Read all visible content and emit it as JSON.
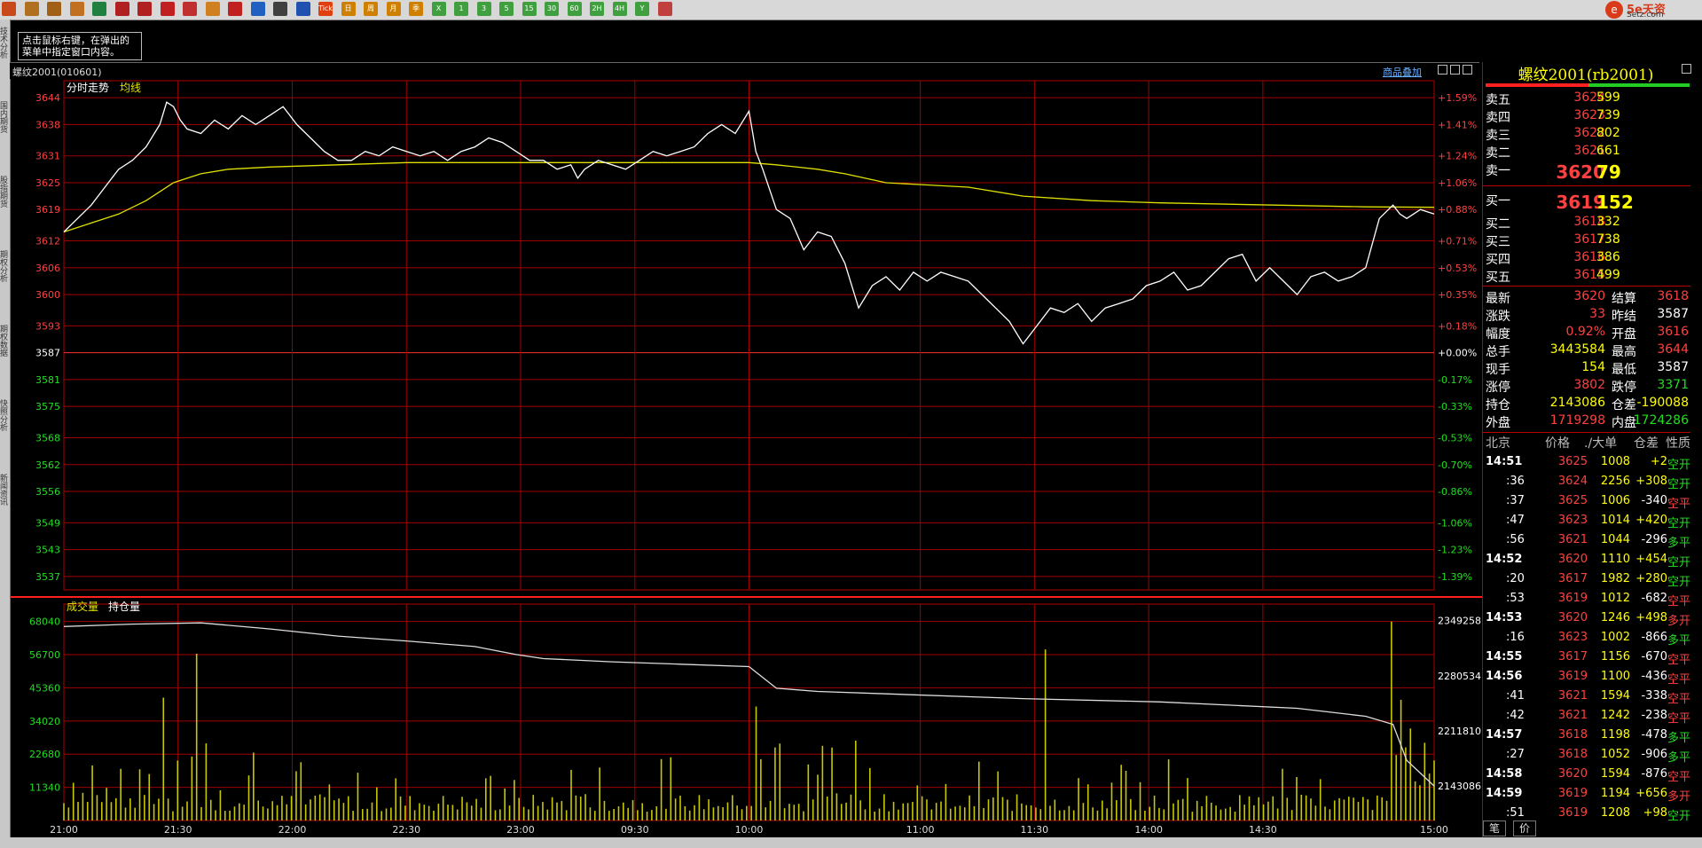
{
  "toolbar": {
    "items": [
      "home-icon",
      "stack-icon",
      "folder-icon",
      "book-icon",
      "refresh-icon",
      "zoom-in-icon",
      "zoom-out-icon",
      "window-icon",
      "pencil-icon",
      "brush-icon",
      "filter-icon",
      "new-icon",
      "table-icon",
      "trend-icon",
      "tick",
      "D",
      "W",
      "M",
      "Q",
      "Y",
      "1",
      "3",
      "5",
      "15",
      "30",
      "60",
      "2H",
      "4H",
      "Y",
      "calc-icon"
    ],
    "labels": {
      "tick": "Tick",
      "D": "日",
      "W": "周",
      "M": "月",
      "Q": "季",
      "Y": "X",
      "1": "1",
      "3": "3",
      "5": "5",
      "15": "15",
      "30": "30",
      "60": "60",
      "2H": "2H",
      "4H": "4H",
      "Yr": "Y"
    }
  },
  "brand": {
    "logo_text": "5e天资",
    "logo_sub": "Setz.com",
    "accent": "#d83a1a"
  },
  "left_tabs": [
    "技术分析",
    "国内期货",
    "股指期货",
    "期权分析",
    "期权数据",
    "快照分析",
    "新闻资讯"
  ],
  "tip": {
    "line1": "点击鼠标右键，在弹出的",
    "line2": "菜单中指定窗口内容。"
  },
  "header": {
    "symbol": "螺纹2001(010601)",
    "overlay_link": "商品叠加"
  },
  "chart_data": {
    "type": "line",
    "panels": [
      {
        "name": "price",
        "legend": [
          "分时走势",
          "均线"
        ],
        "y_ticks": [
          3644,
          3638,
          3631,
          3625,
          3619,
          3612,
          3606,
          3600,
          3593,
          3587,
          3581,
          3575,
          3568,
          3562,
          3556,
          3549,
          3543,
          3537
        ],
        "pct_ticks": [
          "+1.59%",
          "+1.41%",
          "+1.24%",
          "+1.06%",
          "+0.88%",
          "+0.71%",
          "+0.53%",
          "+0.35%",
          "+0.18%",
          "+0.00%",
          "-0.17%",
          "-0.33%",
          "-0.53%",
          "-0.70%",
          "-0.86%",
          "-1.06%",
          "-1.23%",
          "-1.39%"
        ],
        "ylim": [
          3534,
          3647
        ],
        "prev_settle": 3587
      },
      {
        "name": "volume",
        "legend": [
          "成交量",
          "持仓量"
        ],
        "y_ticks": [
          68040,
          56700,
          45360,
          34020,
          22680,
          11340
        ],
        "oi_ticks": [
          2349258,
          2280534,
          2211810,
          2143086
        ],
        "ylim": [
          0,
          74000
        ]
      }
    ],
    "x_ticks": [
      "21:00",
      "21:30",
      "22:00",
      "22:30",
      "23:00",
      "09:30",
      "10:00",
      "11:00",
      "11:30",
      "14:00",
      "14:30",
      "15:00"
    ],
    "x_tick_pos": [
      0,
      0.0833,
      0.1667,
      0.25,
      0.3333,
      0.4167,
      0.5,
      0.625,
      0.7083,
      0.7917,
      0.875,
      1
    ],
    "series": [
      {
        "name": "分时走势",
        "x": [
          0,
          0.01,
          0.02,
          0.03,
          0.04,
          0.05,
          0.06,
          0.07,
          0.075,
          0.08,
          0.085,
          0.09,
          0.1,
          0.11,
          0.12,
          0.13,
          0.14,
          0.15,
          0.16,
          0.17,
          0.18,
          0.19,
          0.2,
          0.21,
          0.22,
          0.23,
          0.24,
          0.25,
          0.26,
          0.27,
          0.28,
          0.29,
          0.3,
          0.31,
          0.32,
          0.33,
          0.34,
          0.35,
          0.36,
          0.37,
          0.375,
          0.38,
          0.39,
          0.4,
          0.41,
          0.42,
          0.43,
          0.44,
          0.45,
          0.46,
          0.47,
          0.48,
          0.49,
          0.5,
          0.505,
          0.51,
          0.52,
          0.53,
          0.54,
          0.55,
          0.56,
          0.57,
          0.58,
          0.59,
          0.6,
          0.61,
          0.62,
          0.63,
          0.64,
          0.65,
          0.66,
          0.67,
          0.68,
          0.69,
          0.7,
          0.71,
          0.72,
          0.73,
          0.74,
          0.75,
          0.76,
          0.77,
          0.78,
          0.79,
          0.8,
          0.81,
          0.82,
          0.83,
          0.84,
          0.85,
          0.86,
          0.87,
          0.88,
          0.89,
          0.9,
          0.91,
          0.92,
          0.93,
          0.94,
          0.95,
          0.96,
          0.97,
          0.975,
          0.98,
          0.99,
          1
        ],
        "values": [
          3614,
          3617,
          3620,
          3624,
          3628,
          3630,
          3633,
          3638,
          3643,
          3642,
          3639,
          3637,
          3636,
          3639,
          3637,
          3640,
          3638,
          3640,
          3642,
          3638,
          3635,
          3632,
          3630,
          3630,
          3632,
          3631,
          3633,
          3632,
          3631,
          3632,
          3630,
          3632,
          3633,
          3635,
          3634,
          3632,
          3630,
          3630,
          3628,
          3629,
          3626,
          3628,
          3630,
          3629,
          3628,
          3630,
          3632,
          3631,
          3632,
          3633,
          3636,
          3638,
          3636,
          3641,
          3632,
          3628,
          3619,
          3617,
          3610,
          3614,
          3613,
          3607,
          3597,
          3602,
          3604,
          3601,
          3605,
          3603,
          3605,
          3604,
          3603,
          3600,
          3597,
          3594,
          3589,
          3593,
          3597,
          3596,
          3598,
          3594,
          3597,
          3598,
          3599,
          3602,
          3603,
          3605,
          3601,
          3602,
          3605,
          3608,
          3609,
          3603,
          3606,
          3603,
          3600,
          3604,
          3605,
          3603,
          3604,
          3606,
          3617,
          3620,
          3618,
          3617,
          3619,
          3618
        ],
        "color": "#ffffff"
      },
      {
        "name": "均线",
        "x": [
          0,
          0.02,
          0.04,
          0.06,
          0.07,
          0.08,
          0.09,
          0.1,
          0.12,
          0.15,
          0.2,
          0.25,
          0.3,
          0.35,
          0.4,
          0.45,
          0.5,
          0.52,
          0.55,
          0.57,
          0.6,
          0.63,
          0.66,
          0.7,
          0.75,
          0.8,
          0.85,
          0.9,
          0.95,
          1
        ],
        "values": [
          3614,
          3616,
          3618,
          3621,
          3623,
          3625,
          3626,
          3627,
          3628,
          3628.5,
          3629,
          3629.5,
          3629.5,
          3629.5,
          3629.5,
          3629.5,
          3629.5,
          3629,
          3628,
          3627,
          3625,
          3624.5,
          3624,
          3622,
          3621,
          3620.5,
          3620.2,
          3619.9,
          3619.6,
          3619.5
        ],
        "color": "#e0e000"
      },
      {
        "name": "持仓量",
        "x": [
          0,
          0.05,
          0.1,
          0.15,
          0.2,
          0.25,
          0.3,
          0.33,
          0.35,
          0.4,
          0.45,
          0.5,
          0.52,
          0.55,
          0.6,
          0.7,
          0.8,
          0.85,
          0.9,
          0.95,
          0.97,
          0.98,
          1
        ],
        "values": [
          2342000,
          2345000,
          2346500,
          2339000,
          2330000,
          2324000,
          2317000,
          2307000,
          2302000,
          2298000,
          2295000,
          2292000,
          2265000,
          2261000,
          2258000,
          2252000,
          2248000,
          2244000,
          2240000,
          2230000,
          2220000,
          2175000,
          2143086
        ],
        "color": "#dddddd"
      }
    ],
    "volume_bars": {
      "color": "#c8c800"
    },
    "grid": true
  },
  "quote": {
    "title": "螺纹2001(rb2001)",
    "asks": [
      {
        "label": "卖五",
        "price": "3624",
        "vol": "599"
      },
      {
        "label": "卖四",
        "price": "3623",
        "vol": "739"
      },
      {
        "label": "卖三",
        "price": "3622",
        "vol": "802"
      },
      {
        "label": "卖二",
        "price": "3621",
        "vol": "661"
      }
    ],
    "ask1": {
      "label": "卖一",
      "price": "3620",
      "vol": "79"
    },
    "bid1": {
      "label": "买一",
      "price": "3619",
      "vol": "152"
    },
    "bids": [
      {
        "label": "买二",
        "price": "3618",
        "vol": "332"
      },
      {
        "label": "买三",
        "price": "3617",
        "vol": "738"
      },
      {
        "label": "买四",
        "price": "3616",
        "vol": "386"
      },
      {
        "label": "买五",
        "price": "3615",
        "vol": "499"
      }
    ],
    "stats": [
      {
        "l1": "最新",
        "v1": "3620",
        "c1": "red",
        "l2": "结算",
        "v2": "3618",
        "c2": "red"
      },
      {
        "l1": "涨跌",
        "v1": "33",
        "c1": "red",
        "l2": "昨结",
        "v2": "3587",
        "c2": "wht"
      },
      {
        "l1": "幅度",
        "v1": "0.92%",
        "c1": "red",
        "l2": "开盘",
        "v2": "3616",
        "c2": "red"
      },
      {
        "l1": "总手",
        "v1": "3443584",
        "c1": "yel",
        "l2": "最高",
        "v2": "3644",
        "c2": "red"
      },
      {
        "l1": "现手",
        "v1": "154",
        "c1": "yel",
        "l2": "最低",
        "v2": "3587",
        "c2": "wht"
      },
      {
        "l1": "涨停",
        "v1": "3802",
        "c1": "red",
        "l2": "跌停",
        "v2": "3371",
        "c2": "green"
      },
      {
        "l1": "持仓",
        "v1": "2143086",
        "c1": "yel",
        "l2": "仓差",
        "v2": "-190088",
        "c2": "yel"
      },
      {
        "l1": "外盘",
        "v1": "1719298",
        "c1": "red",
        "l2": "内盘",
        "v2": "1724286",
        "c2": "green"
      }
    ],
    "trade_header": {
      "time": "北京",
      "price": "价格",
      "vol": "./大单",
      "oi": "仓差",
      "type": "性质"
    },
    "trades": [
      {
        "t": "14:51",
        "p": "3625",
        "v": "1008",
        "d": "+2",
        "k": "空开",
        "kc": "green"
      },
      {
        "t": ":36",
        "p": "3624",
        "v": "2256",
        "d": "+308",
        "k": "空开",
        "kc": "green"
      },
      {
        "t": ":37",
        "p": "3625",
        "v": "1006",
        "d": "-340",
        "k": "空平",
        "kc": "red"
      },
      {
        "t": ":47",
        "p": "3623",
        "v": "1014",
        "d": "+420",
        "k": "空开",
        "kc": "green"
      },
      {
        "t": ":56",
        "p": "3621",
        "v": "1044",
        "d": "-296",
        "k": "多平",
        "kc": "green"
      },
      {
        "t": "14:52",
        "p": "3620",
        "v": "1110",
        "d": "+454",
        "k": "空开",
        "kc": "green"
      },
      {
        "t": ":20",
        "p": "3617",
        "v": "1982",
        "d": "+280",
        "k": "空开",
        "kc": "green"
      },
      {
        "t": ":53",
        "p": "3619",
        "v": "1012",
        "d": "-682",
        "k": "空平",
        "kc": "red"
      },
      {
        "t": "14:53",
        "p": "3620",
        "v": "1246",
        "d": "+498",
        "k": "多开",
        "kc": "red"
      },
      {
        "t": ":16",
        "p": "3623",
        "v": "1002",
        "d": "-866",
        "k": "多平",
        "kc": "green"
      },
      {
        "t": "14:55",
        "p": "3617",
        "v": "1156",
        "d": "-670",
        "k": "空平",
        "kc": "red"
      },
      {
        "t": "14:56",
        "p": "3619",
        "v": "1100",
        "d": "-436",
        "k": "空平",
        "kc": "red"
      },
      {
        "t": ":41",
        "p": "3621",
        "v": "1594",
        "d": "-338",
        "k": "空平",
        "kc": "red"
      },
      {
        "t": ":42",
        "p": "3621",
        "v": "1242",
        "d": "-238",
        "k": "空平",
        "kc": "red"
      },
      {
        "t": "14:57",
        "p": "3618",
        "v": "1198",
        "d": "-478",
        "k": "多平",
        "kc": "green"
      },
      {
        "t": ":27",
        "p": "3618",
        "v": "1052",
        "d": "-906",
        "k": "多平",
        "kc": "green"
      },
      {
        "t": "14:58",
        "p": "3620",
        "v": "1594",
        "d": "-876",
        "k": "空平",
        "kc": "red"
      },
      {
        "t": "14:59",
        "p": "3619",
        "v": "1194",
        "d": "+656",
        "k": "多开",
        "kc": "red"
      },
      {
        "t": ":51",
        "p": "3619",
        "v": "1208",
        "d": "+98",
        "k": "空开",
        "kc": "green"
      }
    ],
    "tabs": [
      "笔",
      "价"
    ]
  }
}
